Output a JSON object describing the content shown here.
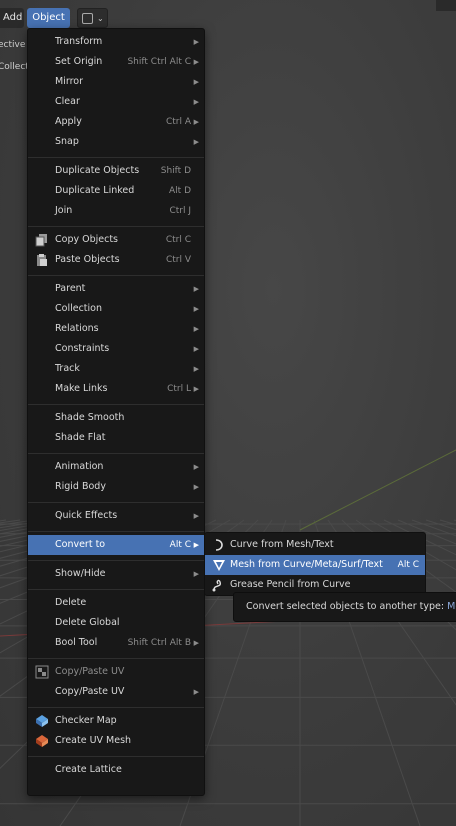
{
  "header": {
    "add_label": "Add",
    "object_label": "Object",
    "side_texts": [
      "ective",
      "Collect"
    ]
  },
  "menu": {
    "items": [
      {
        "label": "Transform",
        "shortcut": "",
        "submenu": true
      },
      {
        "label": "Set Origin",
        "shortcut": "Shift Ctrl Alt C",
        "submenu": true
      },
      {
        "label": "Mirror",
        "shortcut": "",
        "submenu": true
      },
      {
        "label": "Clear",
        "shortcut": "",
        "submenu": true
      },
      {
        "label": "Apply",
        "shortcut": "Ctrl A",
        "submenu": true
      },
      {
        "label": "Snap",
        "shortcut": "",
        "submenu": true
      },
      {
        "label": "Duplicate Objects",
        "shortcut": "Shift D",
        "submenu": false
      },
      {
        "label": "Duplicate Linked",
        "shortcut": "Alt D",
        "submenu": false
      },
      {
        "label": "Join",
        "shortcut": "Ctrl J",
        "submenu": false
      },
      {
        "label": "Copy Objects",
        "shortcut": "Ctrl C",
        "submenu": false,
        "icon": "copy-icon"
      },
      {
        "label": "Paste Objects",
        "shortcut": "Ctrl V",
        "submenu": false,
        "icon": "paste-icon"
      },
      {
        "label": "Parent",
        "shortcut": "",
        "submenu": true
      },
      {
        "label": "Collection",
        "shortcut": "",
        "submenu": true
      },
      {
        "label": "Relations",
        "shortcut": "",
        "submenu": true
      },
      {
        "label": "Constraints",
        "shortcut": "",
        "submenu": true
      },
      {
        "label": "Track",
        "shortcut": "",
        "submenu": true
      },
      {
        "label": "Make Links",
        "shortcut": "Ctrl L",
        "submenu": true
      },
      {
        "label": "Shade Smooth",
        "shortcut": "",
        "submenu": false
      },
      {
        "label": "Shade Flat",
        "shortcut": "",
        "submenu": false
      },
      {
        "label": "Animation",
        "shortcut": "",
        "submenu": true
      },
      {
        "label": "Rigid Body",
        "shortcut": "",
        "submenu": true
      },
      {
        "label": "Quick Effects",
        "shortcut": "",
        "submenu": true
      },
      {
        "label": "Convert to",
        "shortcut": "Alt C",
        "submenu": true,
        "highlighted": true
      },
      {
        "label": "Show/Hide",
        "shortcut": "",
        "submenu": true
      },
      {
        "label": "Delete",
        "shortcut": "",
        "submenu": false
      },
      {
        "label": "Delete Global",
        "shortcut": "",
        "submenu": false
      },
      {
        "label": "Bool Tool",
        "shortcut": "Shift Ctrl Alt B",
        "submenu": true
      },
      {
        "label": "Copy/Paste UV",
        "shortcut": "",
        "submenu": false,
        "icon": "uv-icon",
        "disabled": true
      },
      {
        "label": "Copy/Paste UV",
        "shortcut": "",
        "submenu": true
      },
      {
        "label": "Checker Map",
        "shortcut": "",
        "submenu": false,
        "icon": "checker-map-icon"
      },
      {
        "label": "Create UV Mesh",
        "shortcut": "",
        "submenu": false,
        "icon": "uv-mesh-icon"
      },
      {
        "label": "Create Lattice",
        "shortcut": "",
        "submenu": false
      }
    ]
  },
  "submenu": {
    "items": [
      {
        "label": "Curve from Mesh/Text",
        "shortcut": "",
        "icon": "curve-icon"
      },
      {
        "label": "Mesh from Curve/Meta/Surf/Text",
        "shortcut": "Alt C",
        "icon": "mesh-icon",
        "highlighted": true
      },
      {
        "label": "Grease Pencil from Curve",
        "shortcut": "",
        "icon": "grease-pencil-icon"
      }
    ]
  },
  "tooltip": {
    "text": "Convert selected objects to another type:",
    "keyword": "Mesh"
  },
  "colors": {
    "accent": "#4772b3",
    "menu_bg": "#181818",
    "viewport_bg": "#3d3d3d"
  }
}
